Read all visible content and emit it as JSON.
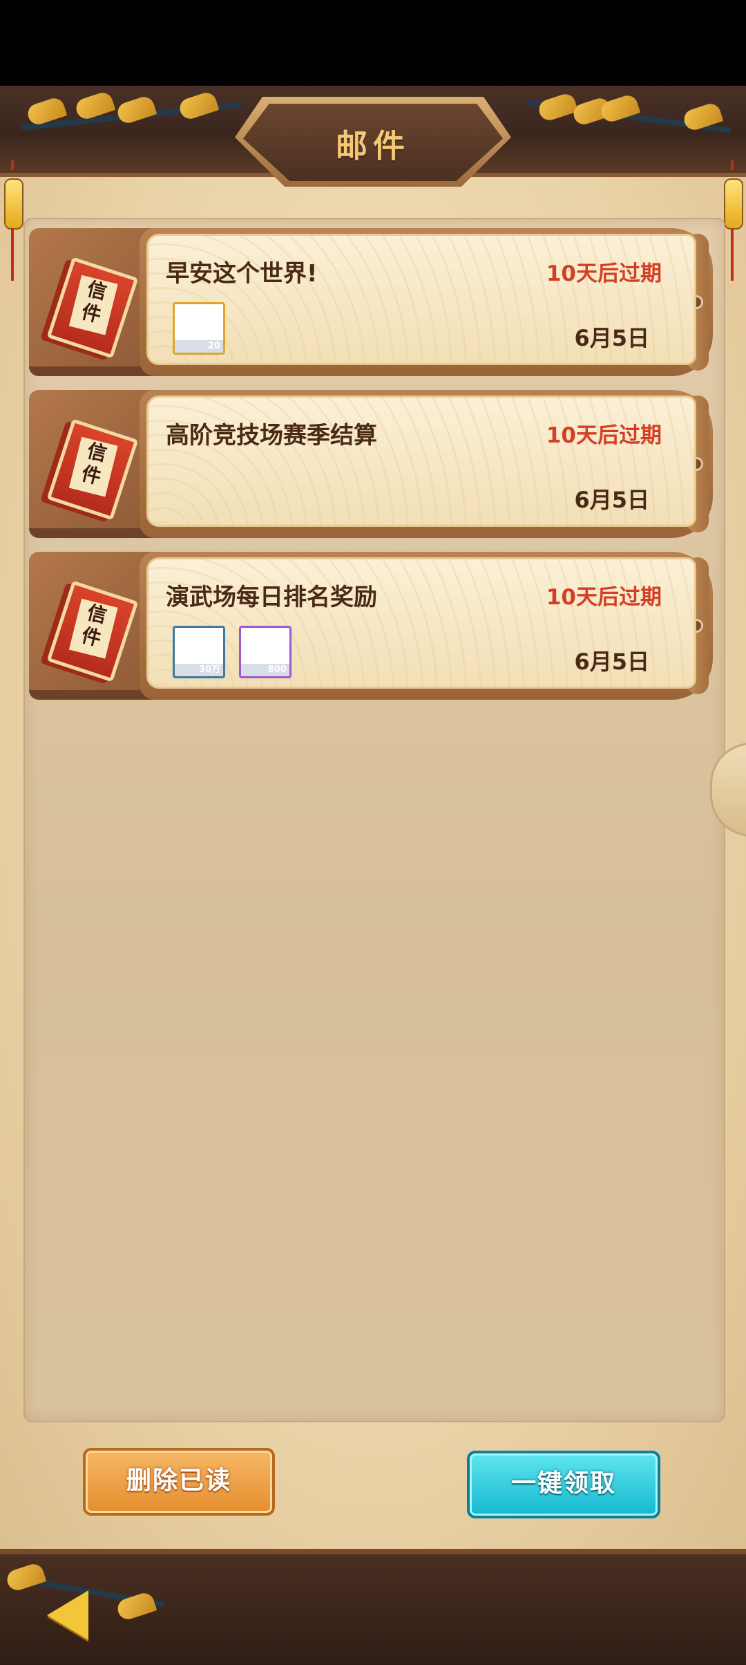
{
  "header": {
    "title": "邮件"
  },
  "mails": [
    {
      "title": "早安这个世界!",
      "expiry": "10天后过期",
      "date": "6月5日",
      "rewards": [
        {
          "qty": "20",
          "border": "#e3a22a"
        }
      ]
    },
    {
      "title": "高阶竞技场赛季结算",
      "expiry": "10天后过期",
      "date": "6月5日",
      "rewards": []
    },
    {
      "title": "演武场每日排名奖励",
      "expiry": "10天后过期",
      "date": "6月5日",
      "rewards": [
        {
          "qty": "30万",
          "border": "#3a7aa0"
        },
        {
          "qty": "800",
          "border": "#9a5ad0"
        }
      ]
    }
  ],
  "mail_icon": {
    "text": "信件",
    "icon": "letter-icon"
  },
  "actions": {
    "delete_read": "删除已读",
    "claim_all": "一键领取"
  },
  "colors": {
    "expiry": "#d33f25",
    "claim_button": "#14b9cf",
    "delete_button": "#e58f2e",
    "title": "#f4c874"
  }
}
